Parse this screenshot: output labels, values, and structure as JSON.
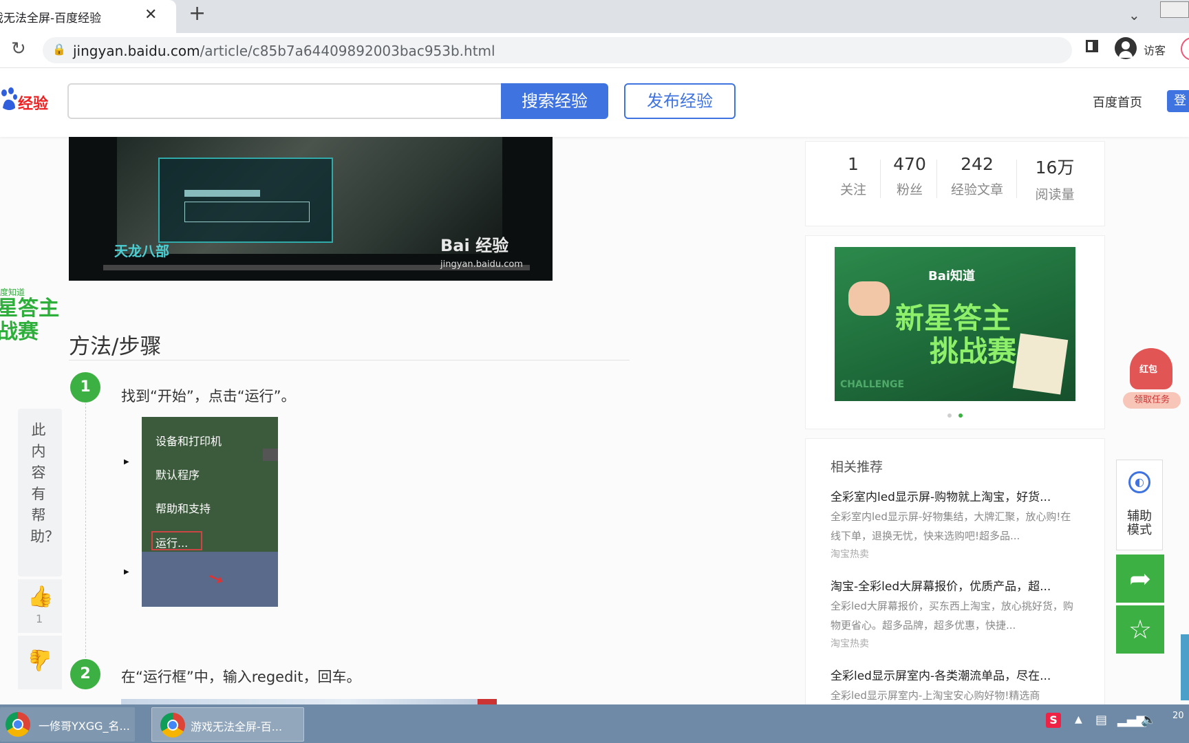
{
  "browser": {
    "tab_title": "戏无法全屏-百度经验",
    "tab_close": "✕",
    "new_tab": "+",
    "tab_list": "⌄",
    "url_host": "jingyan.baidu.com",
    "url_path": "/article/c85b7a64409892003bac953b.html",
    "reload": "↻",
    "lock": "🔒",
    "profile_label": "访客"
  },
  "header": {
    "logo_text": "经验",
    "search_placeholder": "",
    "search_button": "搜索经验",
    "publish_button": "发布经验",
    "home_link": "百度首页",
    "login_button": "登"
  },
  "article": {
    "hero": {
      "watermark_brand": "Bai 经验",
      "watermark_url": "jingyan.baidu.com",
      "game_logo": "天龙八部"
    },
    "section_title": "方法/步骤",
    "steps": [
      {
        "number": "1",
        "text": "找到“开始”，点击“运行”。",
        "menu_items": [
          "设备和打印机",
          "默认程序",
          "帮助和支持",
          "运行..."
        ]
      },
      {
        "number": "2",
        "text": "在“运行框”中，输入regedit，回车。"
      }
    ]
  },
  "left_float": {
    "badge_label": "度知道",
    "badge_text": "星答主\n战赛",
    "helpful_text": "此内容有帮助？",
    "like_count": "1",
    "like_icon": "thumb-up-icon",
    "dislike_icon": "thumb-down-icon"
  },
  "sidebar": {
    "stats": [
      {
        "value": "1",
        "label": "关注"
      },
      {
        "value": "470",
        "label": "粉丝"
      },
      {
        "value": "242",
        "label": "经验文章"
      },
      {
        "value": "16万",
        "label": "阅读量"
      }
    ],
    "banner": {
      "logo": "Bai知道",
      "line1": "新星答主",
      "line2": "挑战赛",
      "footer": "CHALLENGE"
    },
    "related_title": "相关推荐",
    "related": [
      {
        "title": "全彩室内led显示屏-购物就上淘宝，好货...",
        "desc": "全彩室内led显示屏-好物集结，大牌汇聚，放心购!在线下单，退换无忧，快来选购吧!超多品...",
        "source": "淘宝热卖"
      },
      {
        "title": "淘宝-全彩led大屏幕报价，优质产品，超...",
        "desc": "全彩led大屏幕报价，买东西上淘宝，放心挑好货，购物更省心。超多品牌，超多优惠，快捷...",
        "source": "淘宝热卖"
      },
      {
        "title": "全彩led显示屏室内-各类潮流单品，尽在...",
        "desc": "全彩led显示屏室内-上淘宝安心购好物!精选商",
        "source": ""
      }
    ]
  },
  "right_float": {
    "redpack_label": "红包",
    "redpack_button": "领取任务",
    "assist_text": "辅助模式",
    "share_icon": "share-icon",
    "favorite_icon": "star-icon"
  },
  "taskbar": {
    "tasks": [
      {
        "label": "一修哥YXGG_名..."
      },
      {
        "label": "游戏无法全屏-百..."
      }
    ],
    "ime": "S",
    "time": "20"
  }
}
